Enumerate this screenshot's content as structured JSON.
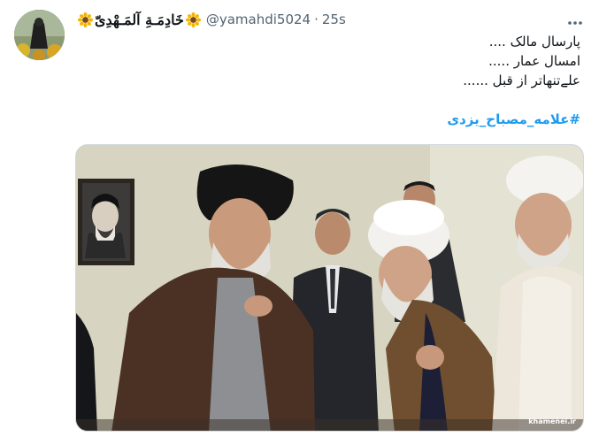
{
  "author": {
    "display_name": "خَادِمَـةِ آلمَـهْدِیّ",
    "handle": "@yamahdi5024",
    "separator": "·",
    "time": "25s",
    "name_emoji": "sunflower"
  },
  "tweet": {
    "lines": [
      "پارسال مالک ....",
      "امسال عمار .....",
      "علےتنهاتر از قبل ......"
    ],
    "hashtag": "#علامه_مصباح_یزدی"
  },
  "media": {
    "watermark": "khamenei.ir"
  },
  "icons": {
    "more": "more-horizontal-icon",
    "flower": "sunflower-icon"
  },
  "colors": {
    "link": "#1d9bf0",
    "secondary_text": "#536471"
  }
}
